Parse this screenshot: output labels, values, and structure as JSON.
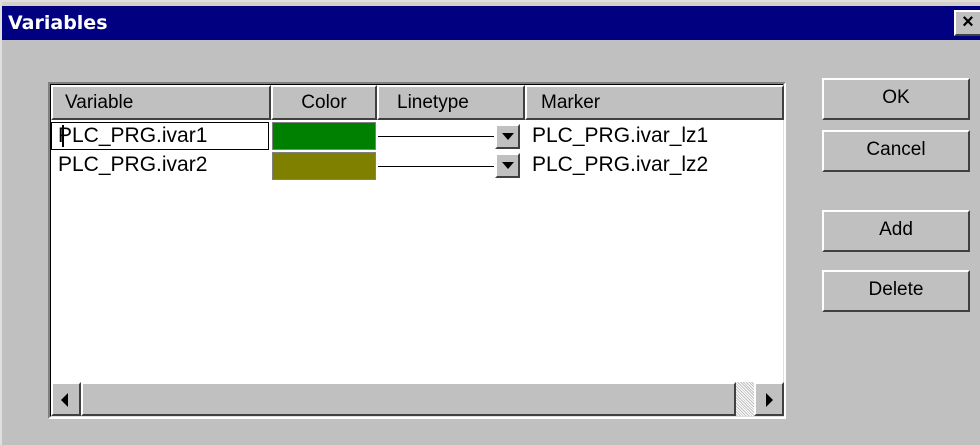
{
  "window": {
    "title": "Variables",
    "close_glyph": "×"
  },
  "table": {
    "columns": [
      "Variable",
      "Color",
      "Linetype",
      "Marker"
    ],
    "rows": [
      {
        "variable": "PLC_PRG.ivar1",
        "color": "#008000",
        "linetype": "solid",
        "marker": "PLC_PRG.ivar_lz1"
      },
      {
        "variable": "PLC_PRG.ivar2",
        "color": "#808000",
        "linetype": "solid",
        "marker": "PLC_PRG.ivar_lz2"
      }
    ]
  },
  "buttons": {
    "ok": "OK",
    "cancel": "Cancel",
    "add": "Add",
    "delete": "Delete"
  },
  "icons": {
    "dropdown": "chevron-down-icon",
    "scroll_left": "arrow-left-icon",
    "scroll_right": "arrow-right-icon",
    "close": "close-icon"
  }
}
